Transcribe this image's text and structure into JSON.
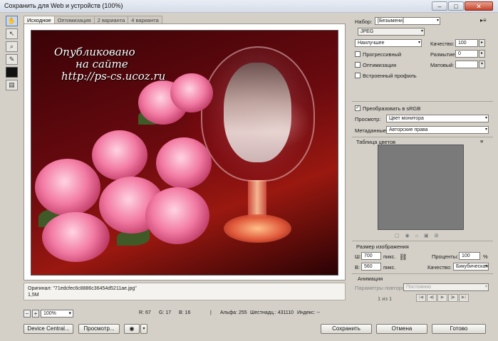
{
  "window": {
    "title": "Сохранить для Web и устройств (100%)",
    "minimize": "–",
    "maximize": "□",
    "close": "✕"
  },
  "tabs": [
    "Исходное",
    "Оптимизация",
    "2 варианта",
    "4 варианта"
  ],
  "watermark": {
    "line1": "Опубликовано",
    "line2": "на сайте",
    "line3": "http://ps-cs.ucoz.ru"
  },
  "status": {
    "original": "Оригинал: \"71edcfec6c8886c36454d5211ae.jpg\"",
    "size": "1,5M"
  },
  "bottom": {
    "zoom": "100%",
    "r": "R: 67",
    "g": "G: 17",
    "b": "B: 16",
    "alpha": "Альфа: 255",
    "hex": "Шестнадц.: 431110",
    "index": "Индекс: --",
    "device_central": "Device Central...",
    "preview": "Просмотр...",
    "save": "Сохранить",
    "cancel": "Отмена",
    "done": "Готово"
  },
  "panel": {
    "preset_label": "Набор:",
    "preset_value": "[Безымени]",
    "format_value": "JPEG",
    "quality_preset": "Наилучшее",
    "quality_label": "Качество:",
    "quality_value": "100",
    "blur_label": "Размытие:",
    "blur_value": "0",
    "matte_label": "Матовый:",
    "matte_value": "",
    "progressive": "Прогрессивный",
    "optimized": "Оптимизация",
    "embed_profile": "Встроенный профиль",
    "convert_srgb": "Преобразовать в sRGB",
    "preview_label": "Просмотр:",
    "preview_value": "Цвет монитора",
    "metadata_label": "Метаданные:",
    "metadata_value": "Авторские права",
    "color_table": "Таблица цветов",
    "image_size": "Размер изображения",
    "width_label": "Ш:",
    "width_value": "700",
    "height_label": "В:",
    "height_value": "560",
    "px": "пикс.",
    "percent_label": "Проценты:",
    "percent_value": "100",
    "percent_sign": "%",
    "resample_label": "Качество:",
    "resample_value": "Бикубическая",
    "animation": "Анимация",
    "loop_label": "Параметры повторов:",
    "loop_value": "Постоянно",
    "frame_counter": "1 из 1"
  },
  "icons": {
    "hand": "hand-tool-icon",
    "slice": "slice-select-tool-icon",
    "zoom": "zoom-tool-icon",
    "eyedropper": "eyedropper-tool-icon",
    "swatch": "eyedropper-color-swatch",
    "toggle_slices": "toggle-slices-icon"
  }
}
